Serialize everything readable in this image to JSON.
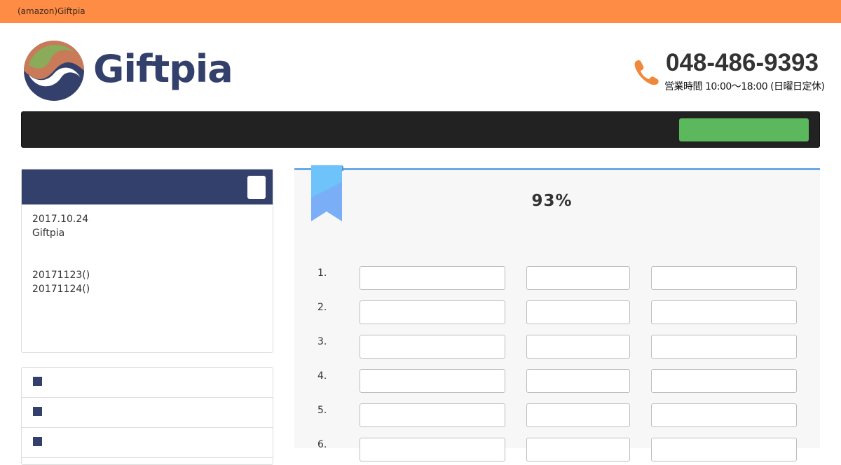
{
  "topbar": {
    "text": "(amazon)Giftpia"
  },
  "header": {
    "logo_text": "Giftpia",
    "phone": "048-486-9393",
    "hours": "営業時間 10:00〜18:00 (日曜日定休)"
  },
  "colors": {
    "topbar": "#ff8c45",
    "navy": "#33406b",
    "nav_bg": "#222222",
    "nav_button": "#5cb85c",
    "accent_blue": "#6aa8e6",
    "phone_icon": "#f0883a"
  },
  "sidebar": {
    "news": [
      "2017.10.24",
      "Giftpia",
      "20171123()",
      "20171124()"
    ],
    "list_items": [
      "",
      "",
      ""
    ]
  },
  "main": {
    "progress_text": "93%",
    "progress_value": 93,
    "rows": [
      {
        "num": "1.",
        "a": "",
        "b": "",
        "c": ""
      },
      {
        "num": "2.",
        "a": "",
        "b": "",
        "c": ""
      },
      {
        "num": "3.",
        "a": "",
        "b": "",
        "c": ""
      },
      {
        "num": "4.",
        "a": "",
        "b": "",
        "c": ""
      },
      {
        "num": "5.",
        "a": "",
        "b": "",
        "c": ""
      },
      {
        "num": "6.",
        "a": "",
        "b": "",
        "c": ""
      }
    ]
  },
  "icons": [
    "phone-icon",
    "bookmark-ribbon-icon",
    "logo-mark-icon",
    "menu-square-icon"
  ]
}
